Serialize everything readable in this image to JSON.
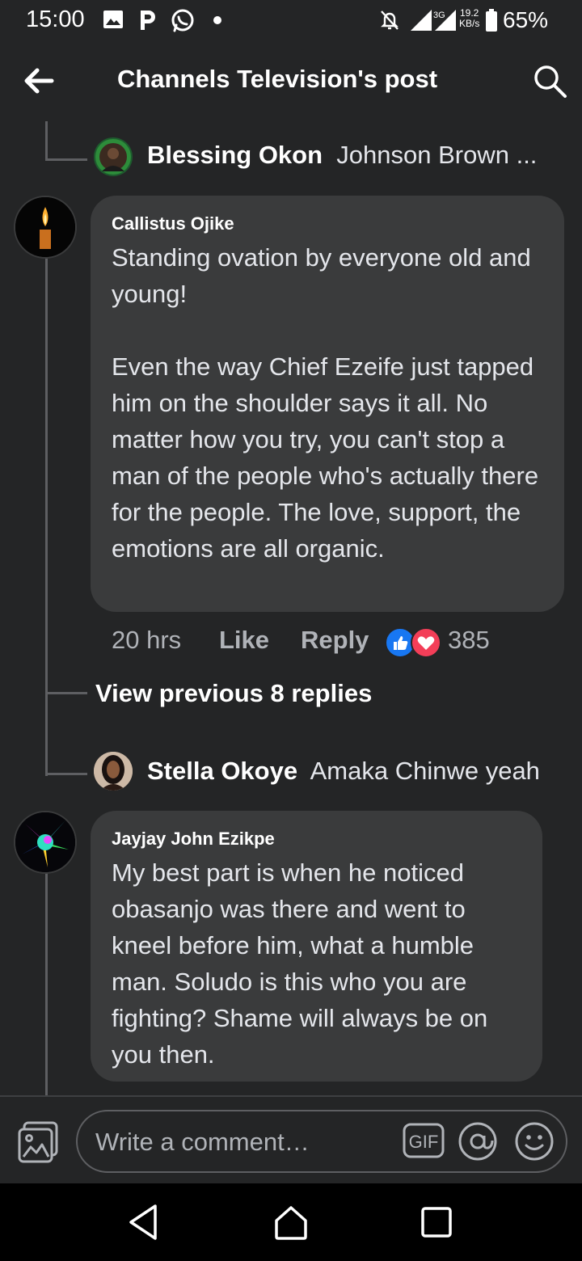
{
  "status_bar": {
    "time": "15:00",
    "network": "3G",
    "speed_value": "19.2",
    "speed_unit": "KB/s",
    "battery": "65%",
    "icons": [
      "gallery-icon",
      "p-icon",
      "whatsapp-icon",
      "notification-dot",
      "muted-bell-icon",
      "signal-icon",
      "battery-icon"
    ]
  },
  "header": {
    "title": "Channels Television's post",
    "back_icon": "back-arrow-icon",
    "search_icon": "search-icon"
  },
  "replies": [
    {
      "name": "Blessing Okon",
      "text": "Johnson Brown ..."
    },
    {
      "name": "Stella Okoye",
      "text": "Amaka Chinwe yeah"
    }
  ],
  "comments": [
    {
      "author": "Callistus Ojike",
      "body": "Standing ovation by everyone old and young!\n\nEven the way Chief Ezeife just tapped him on the shoulder says it all. No matter how you try, you can't stop a man of the people who's actually there for the people. The love, support, the emotions are all organic.",
      "time": "20 hrs",
      "like_label": "Like",
      "reply_label": "Reply",
      "reaction_count": "385",
      "reactions": [
        "like-icon",
        "love-icon"
      ]
    },
    {
      "author": "Jayjay John Ezikpe",
      "body": "My best part is when he noticed obasanjo was there and went to kneel before him, what a humble man. Soludo is this who you are fighting? Shame will always be on you then."
    }
  ],
  "view_previous": "View previous 8 replies",
  "composer": {
    "placeholder": "Write a comment…",
    "gif_label": "GIF"
  },
  "colors": {
    "background": "#242526",
    "bubble": "#3a3b3c",
    "secondary_text": "#b0b3b8",
    "like_blue": "#1877f2",
    "love_red": "#f33e58"
  }
}
